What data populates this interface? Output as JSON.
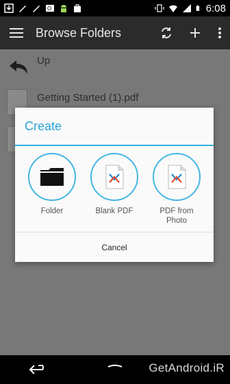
{
  "status_bar": {
    "time": "6:08",
    "icons": [
      "download-icon",
      "brush-icon",
      "brush-icon",
      "outlook-icon",
      "android-icon",
      "bag-icon",
      "vibrate-icon",
      "wifi-icon",
      "signal-icon",
      "battery-icon"
    ]
  },
  "app_bar": {
    "title": "Browse Folders",
    "actions": [
      "refresh-icon",
      "add-icon",
      "overflow-icon"
    ]
  },
  "list": {
    "up_label": "Up",
    "items": [
      {
        "label": "Getting Started (1).pdf"
      }
    ]
  },
  "dialog": {
    "title": "Create",
    "options": [
      {
        "label": "Folder",
        "icon": "folder-icon"
      },
      {
        "label": "Blank PDF",
        "icon": "pdf-icon"
      },
      {
        "label": "PDF from Photo",
        "icon": "pdf-icon"
      }
    ],
    "cancel_label": "Cancel"
  },
  "watermark": "GetAndroid.iR",
  "colors": {
    "accent": "#34aee0",
    "app_bar": "#2b2b2b",
    "scrim": "#787878"
  }
}
